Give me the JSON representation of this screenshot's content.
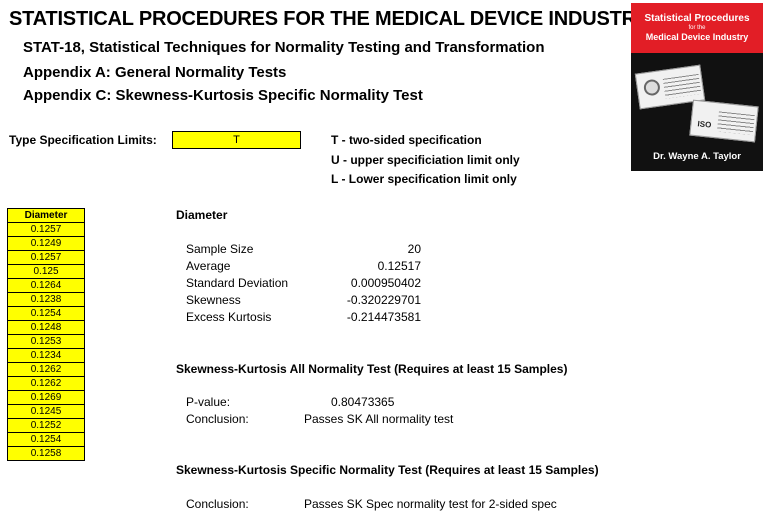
{
  "header": {
    "title": "STATISTICAL PROCEDURES FOR THE MEDICAL DEVICE INDUSTRY",
    "subtitle": "STAT-18, Statistical Techniques for Normality Testing and Transformation",
    "appendix_a": "Appendix A:  General Normality Tests",
    "appendix_c": "Appendix C:  Skewness-Kurtosis Specific Normality Test"
  },
  "book": {
    "title_line1": "Statistical Procedures",
    "title_line2": "for the",
    "title_line3": "Medical Device Industry",
    "iso_text": "ISO",
    "author": "Dr. Wayne A. Taylor",
    "colors": {
      "cover_red": "#e21e26",
      "cover_black": "#111111"
    }
  },
  "spec": {
    "label": "Type Specification Limits:",
    "value": "T",
    "options": [
      "T - two-sided specification",
      "U - upper specificiation limit only",
      "L - Lower specification limit only"
    ]
  },
  "data_column": {
    "header": "Diameter",
    "values": [
      "0.1257",
      "0.1249",
      "0.1257",
      "0.125",
      "0.1264",
      "0.1238",
      "0.1254",
      "0.1248",
      "0.1253",
      "0.1234",
      "0.1262",
      "0.1262",
      "0.1269",
      "0.1245",
      "0.1252",
      "0.1254",
      "0.1258"
    ]
  },
  "stats": {
    "section_title": "Diameter",
    "rows": [
      {
        "label": "Sample Size",
        "value": "20"
      },
      {
        "label": "Average",
        "value": "0.12517"
      },
      {
        "label": "Standard Deviation",
        "value": "0.000950402"
      },
      {
        "label": "Skewness",
        "value": "-0.320229701"
      },
      {
        "label": "Excess Kurtosis",
        "value": "-0.214473581"
      }
    ]
  },
  "sk_all": {
    "title": "Skewness-Kurtosis All Normality Test (Requires at least 15 Samples)",
    "pvalue_label": "P-value:",
    "pvalue": "0.80473365",
    "conclusion_label": "Conclusion:",
    "conclusion": "Passes SK All normality test"
  },
  "sk_spec": {
    "title": "Skewness-Kurtosis Specific Normality Test (Requires at least 15 Samples)",
    "conclusion_label": "Conclusion:",
    "conclusion": "Passes SK Spec normality test for 2-sided spec"
  },
  "colors": {
    "input_fill": "#ffff00"
  }
}
